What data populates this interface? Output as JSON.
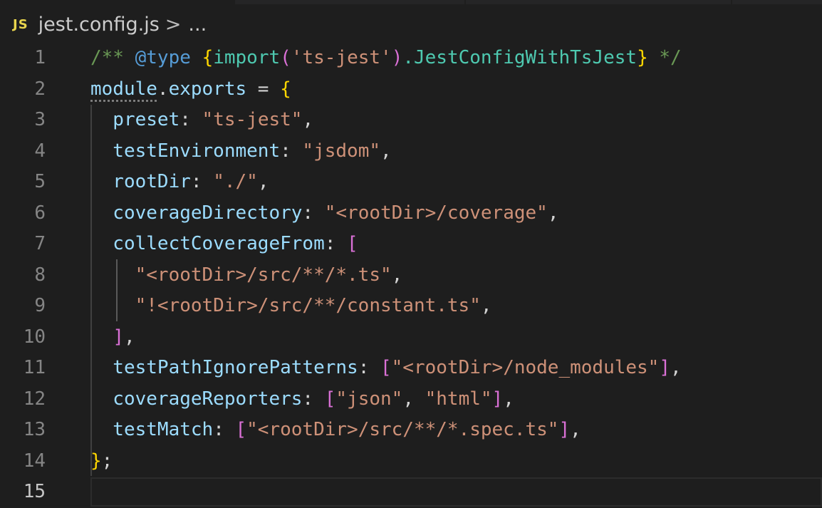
{
  "breadcrumb": {
    "file_icon": "JS",
    "file": "jest.config.js",
    "separator": ">",
    "more": "..."
  },
  "editor": {
    "active_line": 15,
    "lines": [
      {
        "number": "1",
        "tokens": [
          {
            "t": "/** ",
            "c": "comment"
          },
          {
            "t": "@type",
            "c": "doctag"
          },
          {
            "t": " ",
            "c": "comment"
          },
          {
            "t": "{",
            "c": "brace"
          },
          {
            "t": "import",
            "c": "type"
          },
          {
            "t": "(",
            "c": "brace2"
          },
          {
            "t": "'ts-jest'",
            "c": "str"
          },
          {
            "t": ")",
            "c": "brace2"
          },
          {
            "t": ".JestConfigWithTsJest",
            "c": "type"
          },
          {
            "t": "}",
            "c": "brace"
          },
          {
            "t": " */",
            "c": "comment"
          }
        ]
      },
      {
        "number": "2",
        "tokens": [
          {
            "t": "module",
            "c": "var squiggle"
          },
          {
            "t": ".",
            "c": "plain"
          },
          {
            "t": "exports",
            "c": "var"
          },
          {
            "t": " = ",
            "c": "plain"
          },
          {
            "t": "{",
            "c": "brace"
          }
        ]
      },
      {
        "number": "3",
        "tokens": [
          {
            "t": "  preset",
            "c": "var"
          },
          {
            "t": ": ",
            "c": "plain"
          },
          {
            "t": "\"ts-jest\"",
            "c": "str"
          },
          {
            "t": ",",
            "c": "plain"
          }
        ]
      },
      {
        "number": "4",
        "tokens": [
          {
            "t": "  testEnvironment",
            "c": "var"
          },
          {
            "t": ": ",
            "c": "plain"
          },
          {
            "t": "\"jsdom\"",
            "c": "str"
          },
          {
            "t": ",",
            "c": "plain"
          }
        ]
      },
      {
        "number": "5",
        "tokens": [
          {
            "t": "  rootDir",
            "c": "var"
          },
          {
            "t": ": ",
            "c": "plain"
          },
          {
            "t": "\"./\"",
            "c": "str"
          },
          {
            "t": ",",
            "c": "plain"
          }
        ]
      },
      {
        "number": "6",
        "tokens": [
          {
            "t": "  coverageDirectory",
            "c": "var"
          },
          {
            "t": ": ",
            "c": "plain"
          },
          {
            "t": "\"<rootDir>/coverage\"",
            "c": "str"
          },
          {
            "t": ",",
            "c": "plain"
          }
        ]
      },
      {
        "number": "7",
        "tokens": [
          {
            "t": "  collectCoverageFrom",
            "c": "var"
          },
          {
            "t": ": ",
            "c": "plain"
          },
          {
            "t": "[",
            "c": "brace2"
          }
        ]
      },
      {
        "number": "8",
        "tokens": [
          {
            "t": "    \"<rootDir>/src/**/*.ts\"",
            "c": "str"
          },
          {
            "t": ",",
            "c": "plain"
          }
        ]
      },
      {
        "number": "9",
        "tokens": [
          {
            "t": "    \"!<rootDir>/src/**/constant.ts\"",
            "c": "str"
          },
          {
            "t": ",",
            "c": "plain"
          }
        ]
      },
      {
        "number": "10",
        "tokens": [
          {
            "t": "  ",
            "c": "plain"
          },
          {
            "t": "]",
            "c": "brace2"
          },
          {
            "t": ",",
            "c": "plain"
          }
        ]
      },
      {
        "number": "11",
        "tokens": [
          {
            "t": "  testPathIgnorePatterns",
            "c": "var"
          },
          {
            "t": ": ",
            "c": "plain"
          },
          {
            "t": "[",
            "c": "brace2"
          },
          {
            "t": "\"<rootDir>/node_modules\"",
            "c": "str"
          },
          {
            "t": "]",
            "c": "brace2"
          },
          {
            "t": ",",
            "c": "plain"
          }
        ]
      },
      {
        "number": "12",
        "tokens": [
          {
            "t": "  coverageReporters",
            "c": "var"
          },
          {
            "t": ": ",
            "c": "plain"
          },
          {
            "t": "[",
            "c": "brace2"
          },
          {
            "t": "\"json\"",
            "c": "str"
          },
          {
            "t": ", ",
            "c": "plain"
          },
          {
            "t": "\"html\"",
            "c": "str"
          },
          {
            "t": "]",
            "c": "brace2"
          },
          {
            "t": ",",
            "c": "plain"
          }
        ]
      },
      {
        "number": "13",
        "tokens": [
          {
            "t": "  testMatch",
            "c": "var"
          },
          {
            "t": ": ",
            "c": "plain"
          },
          {
            "t": "[",
            "c": "brace2"
          },
          {
            "t": "\"<rootDir>/src/**/*.spec.ts\"",
            "c": "str"
          },
          {
            "t": "]",
            "c": "brace2"
          },
          {
            "t": ",",
            "c": "plain"
          }
        ]
      },
      {
        "number": "14",
        "tokens": [
          {
            "t": "}",
            "c": "brace"
          },
          {
            "t": ";",
            "c": "plain"
          }
        ]
      },
      {
        "number": "15",
        "tokens": []
      }
    ]
  },
  "colors": {
    "background": "#1e1e1e",
    "comment": "#6a9955",
    "keyword_tag": "#569cd6",
    "type": "#4ec9b0",
    "brace": "#ffd700",
    "bracket": "#da70d6",
    "property": "#9cdcfe",
    "string": "#ce9178",
    "js_icon": "#e8d44d"
  }
}
